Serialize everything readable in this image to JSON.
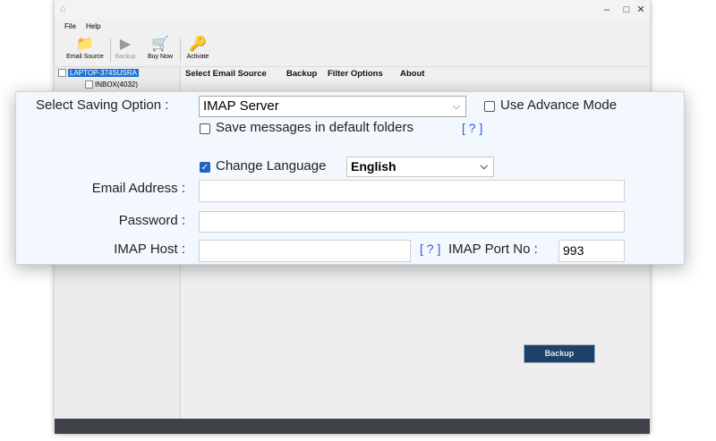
{
  "window": {
    "title": ""
  },
  "menu": {
    "file": "File",
    "help": "Help"
  },
  "toolbar": {
    "email_source": "Email Source",
    "backup": "Backup",
    "buy_now": "Buy Now",
    "activate": "Activate"
  },
  "tree": {
    "root": "LAPTOP-374SUSRA",
    "child": "INBOX(4032)"
  },
  "tabs": [
    "Select Email Source",
    "Backup",
    "Filter Options",
    "About"
  ],
  "form": {
    "saving_option_label": "Select Saving Option :",
    "saving_option_value": "IMAP Server",
    "advance_mode_label": "Use Advance Mode",
    "advance_mode_checked": false,
    "default_folders_label": "Save messages in default folders",
    "default_folders_checked": false,
    "help_link": "[ ? ]",
    "change_language_label": "Change Language",
    "change_language_checked": true,
    "language_value": "English",
    "email_label": "Email Address :",
    "email_value": "",
    "password_label": "Password :",
    "password_value": "",
    "imap_host_label": "IMAP Host :",
    "imap_host_value": "",
    "imap_port_label": "IMAP Port No :",
    "imap_port_value": "993"
  },
  "backup_button": "Backup",
  "colors": {
    "accent": "#1e63c6",
    "backup_button": "#1d4168",
    "statusbar": "#3f4248"
  }
}
